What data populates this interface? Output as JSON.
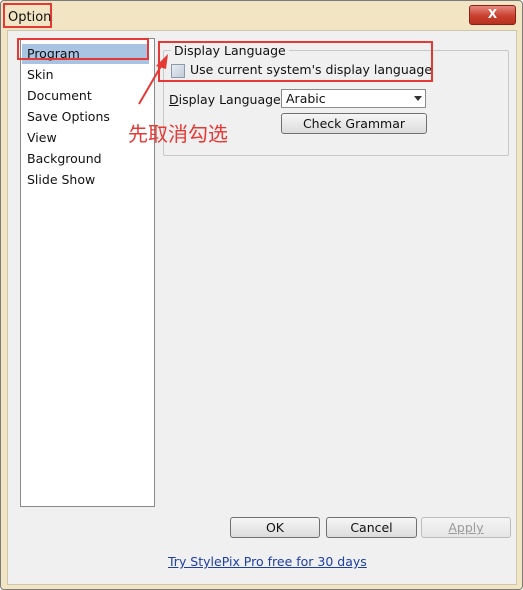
{
  "window": {
    "title": "Option",
    "close_symbol": "X"
  },
  "sidebar": {
    "items": [
      {
        "label": "Program",
        "active": true
      },
      {
        "label": "Skin"
      },
      {
        "label": "Document"
      },
      {
        "label": "Save Options"
      },
      {
        "label": "View"
      },
      {
        "label": "Background"
      },
      {
        "label": "Slide Show"
      }
    ]
  },
  "display_language": {
    "group_title": "Display Language",
    "checkbox_label": "Use current system's display language",
    "checkbox_checked": false,
    "label_mnemonic": "D",
    "label_rest": "isplay Language:",
    "selected_language": "Arabic",
    "check_grammar_label": "Check Grammar"
  },
  "annotation": {
    "text": "先取消勾选",
    "color": "#e53935"
  },
  "buttons": {
    "ok": "OK",
    "cancel": "Cancel",
    "apply": "Apply"
  },
  "footer": {
    "link_text": "Try StylePix Pro free for 30 days"
  }
}
